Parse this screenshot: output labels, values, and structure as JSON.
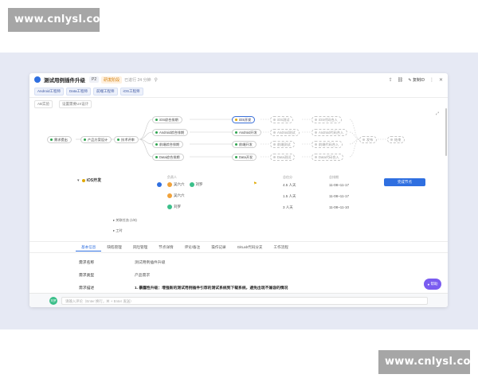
{
  "watermark": {
    "top": "www.cnlysl.com",
    "bottom": "www.cnlysl.com"
  },
  "header": {
    "title": "测试用例插件升级",
    "priority": "P2",
    "stage": "研发阶段",
    "updated": "已进行 24 分钟",
    "copy_id_label": "复制ID"
  },
  "role_tags": [
    "Android工程师",
    "Data工程师",
    "前端工程师",
    "iOS工程师"
  ],
  "path_tabs": [
    "AB实验",
    "设置需要UX设计"
  ],
  "flow": {
    "nodes": [
      {
        "label": "需求提出",
        "state": "done"
      },
      {
        "label": "产品方案设计",
        "state": "done"
      },
      {
        "label": "技术评审",
        "state": "done"
      },
      {
        "label": "iOS综合排期",
        "state": "done"
      },
      {
        "label": "Android综合排期",
        "state": "done"
      },
      {
        "label": "前端综合排期",
        "state": "done"
      },
      {
        "label": "Data综合排期",
        "state": "done"
      },
      {
        "label": "iOS开发",
        "state": "active"
      },
      {
        "label": "Android开发",
        "state": "done"
      },
      {
        "label": "前端开发",
        "state": "done"
      },
      {
        "label": "Data开发",
        "state": "done"
      },
      {
        "label": "iOS测试",
        "state": "pending"
      },
      {
        "label": "Android测试",
        "state": "pending"
      },
      {
        "label": "前端测试",
        "state": "pending"
      },
      {
        "label": "Data测试",
        "state": "pending"
      },
      {
        "label": "iOS代码合入",
        "state": "pending"
      },
      {
        "label": "Android代码合入",
        "state": "pending"
      },
      {
        "label": "前端代码合入",
        "state": "pending"
      },
      {
        "label": "Data代码合入",
        "state": "pending"
      },
      {
        "label": "发布",
        "state": "pending"
      },
      {
        "label": "结束",
        "state": "pending"
      }
    ]
  },
  "detail": {
    "node_title": "iOS开发",
    "col_assignee": "负责人",
    "col_estimate": "总估分",
    "col_schedule": "总排期",
    "rows": [
      {
        "assignees": [
          "吴六六",
          "刘罗"
        ],
        "estimate": "4.5 人天",
        "schedule": "11-08~11-17"
      },
      {
        "assignees": [
          "吴六六"
        ],
        "estimate": "1.5 人天",
        "schedule": "11-08~11-17"
      },
      {
        "assignees": [
          "刘罗"
        ],
        "estimate": "3 人天",
        "schedule": "11-08~11-10"
      }
    ],
    "finish_button": "完成节点",
    "expand_1": "关联任务 (1/8)",
    "expand_2": "工时"
  },
  "tabs": [
    "基本信息",
    "缺陷管理",
    "风险管理",
    "节点详情",
    "评论/备注",
    "操作记录",
    "GitLab代码分支",
    "工作流程"
  ],
  "fields": [
    {
      "label": "需求名称",
      "value": "测试用例插件升级"
    },
    {
      "label": "需求类型",
      "value": "产品需求"
    },
    {
      "label": "需求描述",
      "value": "1. 暴露性升级：增强新的测试用例插件引荐的测试系统到下载系统，避免出现不兼容的情况"
    }
  ],
  "help_button": "帮助",
  "comment": {
    "avatar": "刘罗",
    "placeholder": "请输入评论（Enter 换行，⌘ + Enter 发送）"
  },
  "colors": {
    "accent": "#2f6fe0",
    "done": "#2ea44f",
    "active": "#e0a800",
    "help": "#7a5cf0"
  }
}
